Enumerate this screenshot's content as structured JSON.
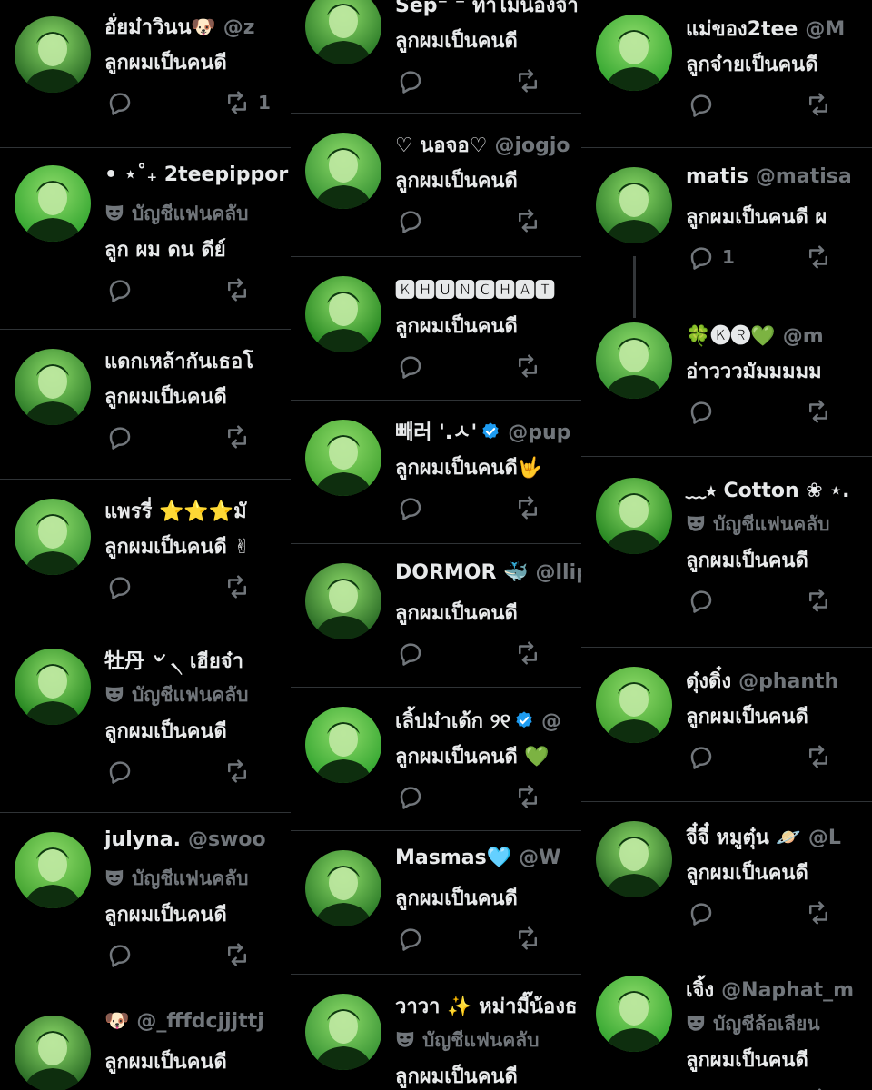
{
  "columns": {
    "left": [
      {
        "name": "อั่ยม๋าวินน🐶",
        "handle": "@z",
        "fan": "",
        "body": "ลูกผมเป็นคนดี",
        "reply_count": "",
        "retweet_count": "1"
      },
      {
        "name": "• ⋆˚₊ 2teepippor",
        "handle": "",
        "fan": "บัญชีแฟนคลับ",
        "body": "ลูก ผม ดน ดีย์",
        "reply_count": "",
        "retweet_count": ""
      },
      {
        "name": "แดกเหล้ากันเธอโ",
        "handle": "",
        "fan": "",
        "body": "ลูกผมเป็นคนดี",
        "reply_count": "",
        "retweet_count": ""
      },
      {
        "name": "แพรรี่ ⭐⭐⭐มั",
        "handle": "",
        "fan": "",
        "body": "ลูกผมเป็นคนดี ✌",
        "reply_count": "",
        "retweet_count": ""
      },
      {
        "name": "牡丹 ৺ ৲ เฮียจ๋า",
        "handle": "",
        "fan": "บัญชีแฟนคลับ",
        "body": "ลูกผมเป็นคนดี",
        "reply_count": "",
        "retweet_count": ""
      },
      {
        "name": "julyna.",
        "handle": "@swoo",
        "fan": "บัญชีแฟนคลับ",
        "body": "ลูกผมเป็นคนดี",
        "reply_count": "",
        "retweet_count": ""
      },
      {
        "name": "🐶",
        "handle": "@_fffdcjjjttj",
        "fan": "",
        "body": "ลูกผมเป็นคนดี",
        "reply_count": "",
        "retweet_count": ""
      }
    ],
    "middle": [
      {
        "name": "Sep⁻ ⁻ ทำไมน้องจ๋า",
        "handle": "",
        "fan": "",
        "body": "ลูกผมเป็นคนดี",
        "reply_count": "",
        "retweet_count": ""
      },
      {
        "name": "♡ นอจอ♡",
        "handle": "@jogjo",
        "fan": "",
        "body": "ลูกผมเป็นคนดี",
        "reply_count": "",
        "retweet_count": ""
      },
      {
        "name": "🅺🅷🆄🅽🅲🅷🅰🆃",
        "handle": "",
        "fan": "",
        "body": "ลูกผมเป็นคนดี",
        "reply_count": "",
        "retweet_count": ""
      },
      {
        "name": "빼러 '.ㅅ'",
        "handle": "@pup",
        "fan": "",
        "body": "ลูกผมเป็นคนดี🤟",
        "reply_count": "",
        "retweet_count": ""
      },
      {
        "name": "DORMOR 🐳",
        "handle": "@llip",
        "fan": "",
        "body": "ลูกผมเป็นคนดี",
        "reply_count": "",
        "retweet_count": ""
      },
      {
        "name": "เลิ้ปม๋าเด้ก ୨୧",
        "handle": "@",
        "fan": "",
        "body": "ลูกผมเป็นคนดี 💚",
        "reply_count": "",
        "retweet_count": ""
      },
      {
        "name": "Masmas🩵",
        "handle": "@W",
        "fan": "",
        "body": "ลูกผมเป็นคนดี",
        "reply_count": "",
        "retweet_count": ""
      },
      {
        "name": "วาวา ✨ หม่ามี๊น้องธ",
        "handle": "",
        "fan": "บัญชีแฟนคลับ",
        "body": "ลูกผมเป็นคนดี",
        "reply_count": "",
        "retweet_count": ""
      }
    ],
    "right": [
      {
        "name": "แม่ของ2tee",
        "handle": "@M",
        "fan": "",
        "body": "ลูกจ๋ายเป็นคนดี",
        "reply_count": "",
        "retweet_count": ""
      },
      {
        "name": "matis",
        "handle": "@matisa",
        "fan": "",
        "body": "ลูกผมเป็นคนดี ผ",
        "reply_count": "1",
        "retweet_count": ""
      },
      {
        "name": "🍀🅚🅡💚",
        "handle": "@m",
        "fan": "",
        "body": "อ่าวววมัมมมมม",
        "reply_count": "",
        "retweet_count": ""
      },
      {
        "name": "﹏⭒ Cotton ❀ ⋆.",
        "handle": "",
        "fan": "บัญชีแฟนคลับ",
        "body": "ลูกผมเป็นคนดี",
        "reply_count": "",
        "retweet_count": ""
      },
      {
        "name": "ดุ๋งดิ๋ง",
        "handle": "@phanth",
        "fan": "",
        "body": "ลูกผมเป็นคนดี",
        "reply_count": "",
        "retweet_count": ""
      },
      {
        "name": "จี๋จี๋ หมูตุ๋น 🪐",
        "handle": "@L",
        "fan": "",
        "body": "ลูกผมเป็นคนดี",
        "reply_count": "",
        "retweet_count": ""
      },
      {
        "name": "เจิ้ง",
        "handle": "@Naphat_m",
        "fan": "บัญชีล้อเลียน",
        "body": "ลูกผมเป็นคนดี",
        "reply_count": "",
        "retweet_count": ""
      }
    ]
  },
  "icons": {
    "reply": "reply-icon",
    "retweet": "retweet-icon",
    "verified": "verified-badge-icon",
    "fan": "theater-mask-icon"
  },
  "colors": {
    "background": "#000000",
    "text": "#e7e9ea",
    "muted": "#71767b",
    "verified": "#1d9bf0",
    "avatar_green": "#2ecc40"
  }
}
